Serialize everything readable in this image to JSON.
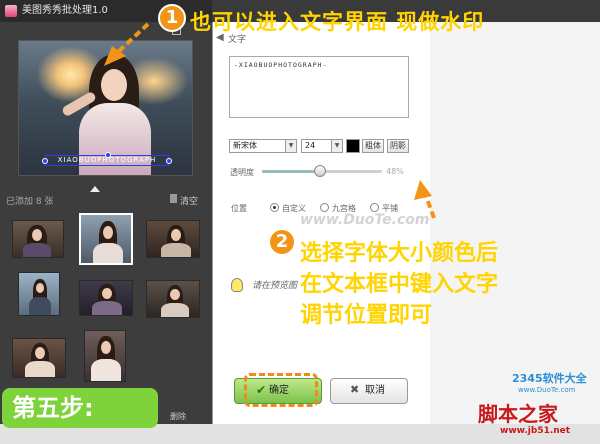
{
  "window": {
    "title": "美图秀秀批处理1.0"
  },
  "preview": {
    "watermark_text": "XIAOBUOPHOTOGRAPH"
  },
  "thumbnails": {
    "added_count_label": "已添加 8 张",
    "clear_label": "清空",
    "delete_label": "删除"
  },
  "text_panel": {
    "section_label": "文字",
    "text_value": "-XIAOBUOPHOTOGRAPH-",
    "font_value": "新宋体",
    "size_value": "24",
    "bold_label": "粗体",
    "shadow_label": "阴影",
    "opacity_label": "透明度",
    "opacity_value": "48%",
    "opacity_percent": 48,
    "position_label": "位置",
    "position_options": [
      "自定义",
      "九宫格",
      "平铺"
    ],
    "hint_text": "请在预览图",
    "ok_label": "确定",
    "cancel_label": "取消"
  },
  "annotations": {
    "step1_number": "1",
    "step1_text": "也可以进入文字界面 现做水印",
    "step2_number": "2",
    "step2_lines": [
      "选择字体大小颜色后",
      "在文本框中键入文字",
      "调节位置即可"
    ],
    "step_badge": "第五步:"
  },
  "watermarks": {
    "duota": "www.DuoTe.com",
    "brand_2345": "2345软件大全",
    "duotecom": "www.DuoTe.com",
    "jiaoben": "脚本之家",
    "jb51": "www.jb51.net"
  },
  "colors": {
    "accent_yellow": "#ffd400",
    "badge_green": "#7ed33a",
    "orange": "#f29418"
  }
}
